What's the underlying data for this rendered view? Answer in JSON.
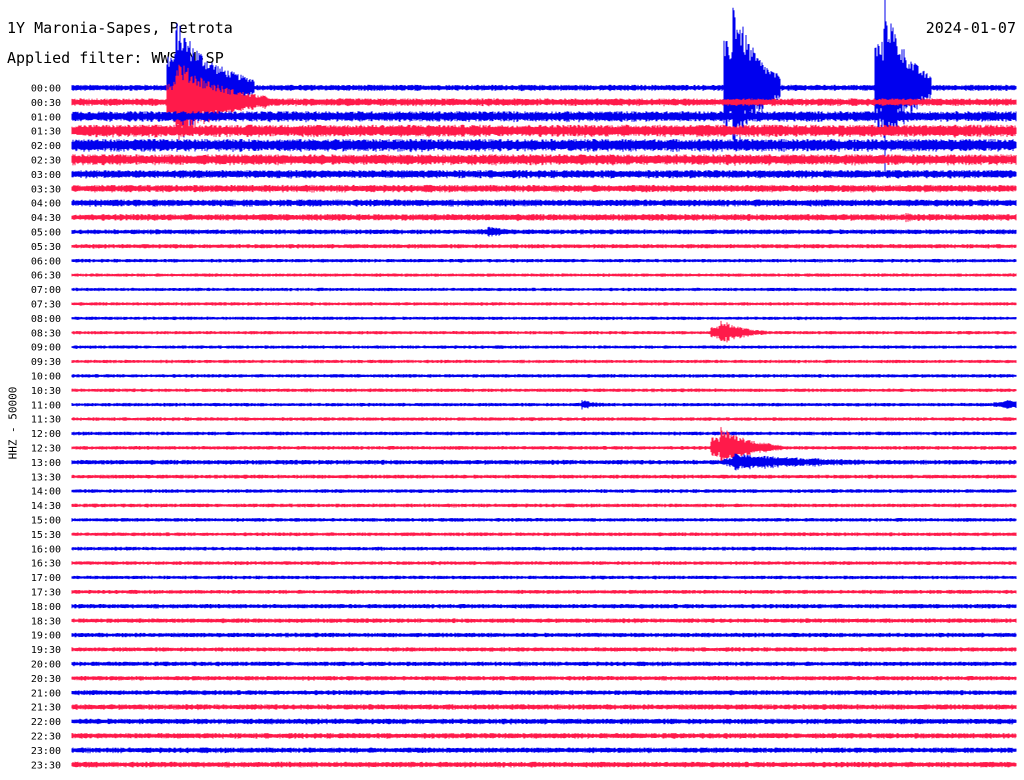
{
  "header": {
    "station": "1Y Maronia-Sapes, Petrota",
    "date": "2024-01-07",
    "filter": "Applied filter: WWSSN-SP"
  },
  "colors": {
    "trace_even": "#0000ee",
    "trace_odd": "#ff1a4a",
    "background": "#ffffff",
    "text": "#000000"
  },
  "chart_data": {
    "type": "helicorder",
    "title": "1Y Maronia-Sapes, Petrota",
    "subtitle": "Applied filter: WWSSN-SP",
    "date": "2024-01-07",
    "ylabel": "HHZ - 50000",
    "row_labels": [
      "00:00",
      "00:30",
      "01:00",
      "01:30",
      "02:00",
      "02:30",
      "03:00",
      "03:30",
      "04:00",
      "04:30",
      "05:00",
      "05:30",
      "06:00",
      "06:30",
      "07:00",
      "07:30",
      "08:00",
      "08:30",
      "09:00",
      "09:30",
      "10:00",
      "10:30",
      "11:00",
      "11:30",
      "12:00",
      "12:30",
      "13:00",
      "13:30",
      "14:00",
      "14:30",
      "15:00",
      "15:30",
      "16:00",
      "16:30",
      "17:00",
      "17:30",
      "18:00",
      "18:30",
      "19:00",
      "19:30",
      "20:00",
      "20:30",
      "21:00",
      "21:30",
      "22:00",
      "22:30",
      "23:00",
      "23:30"
    ],
    "row_minutes": 30,
    "trace_colors": [
      "#0000ee",
      "#ff1a4a"
    ],
    "noise_level": [
      3.2,
      4.0,
      5.6,
      6.5,
      6.6,
      5.7,
      4.3,
      3.9,
      3.7,
      3.5,
      2.6,
      2.3,
      1.9,
      1.8,
      1.8,
      1.8,
      1.8,
      1.8,
      1.8,
      1.8,
      1.9,
      1.9,
      1.9,
      1.9,
      2.0,
      2.0,
      2.5,
      2.1,
      2.0,
      2.0,
      2.0,
      2.0,
      2.0,
      2.0,
      1.9,
      2.1,
      2.4,
      2.4,
      2.4,
      2.3,
      2.4,
      2.4,
      2.6,
      2.9,
      3.0,
      2.9,
      2.9,
      3.0
    ],
    "events": [
      {
        "row": 0,
        "minute": 3.3,
        "amplitude": 70,
        "duration": 2.5
      },
      {
        "row": 0,
        "minute": 21.0,
        "amplitude": 95,
        "duration": 1.5
      },
      {
        "row": 0,
        "minute": 25.8,
        "amplitude": 95,
        "duration": 1.5
      },
      {
        "row": 1,
        "minute": 3.3,
        "amplitude": 45,
        "duration": 3
      },
      {
        "row": 17,
        "minute": 20.6,
        "amplitude": 14,
        "duration": 1.5
      },
      {
        "row": 25,
        "minute": 20.6,
        "amplitude": 22,
        "duration": 2
      },
      {
        "row": 26,
        "minute": 21.0,
        "amplitude": 9,
        "duration": 7
      },
      {
        "row": 10,
        "minute": 13.2,
        "amplitude": 6,
        "duration": 2
      },
      {
        "row": 9,
        "minute": 26.5,
        "amplitude": 5,
        "duration": 1.5
      },
      {
        "row": 22,
        "minute": 16.2,
        "amplitude": 5,
        "duration": 1.5
      },
      {
        "row": 22,
        "minute": 29.6,
        "amplitude": 6,
        "duration": 1.5
      }
    ]
  }
}
